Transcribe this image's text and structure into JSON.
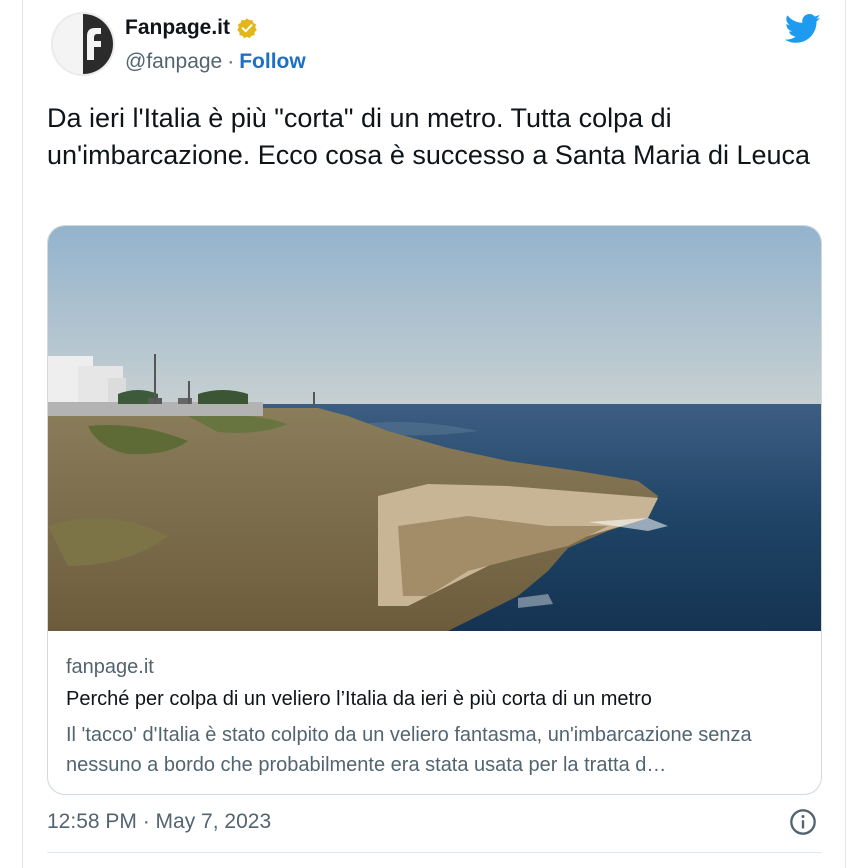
{
  "account": {
    "display_name": "Fanpage.it",
    "handle": "@fanpage",
    "separator": "·",
    "follow_label": "Follow"
  },
  "tweet": {
    "text": "Da ieri l'Italia è più \"corta\" di un metro. Tutta colpa di un'imbarcazione. Ecco cosa è successo a Santa Maria di Leuca",
    "timestamp": "12:58 PM · May 7, 2023"
  },
  "link_card": {
    "domain": "fanpage.it",
    "title": "Perché per colpa di un veliero l’Italia da ieri è più corta di un metro",
    "description": "Il 'tacco' d'Italia è stato colpito da un veliero fantasma, un'imbarcazione senza nessuno a bordo che probabilmente era stata usata per la tratta d…"
  },
  "icons": {
    "avatar": "fanpage-logo",
    "verified": "verified-badge-icon",
    "brand": "twitter-bird-icon",
    "info": "info-icon"
  },
  "colors": {
    "twitter_blue": "#1d9bf0",
    "follow_link": "#1d70c4",
    "verified_gold": "#e2b719",
    "secondary_text": "#536471"
  }
}
